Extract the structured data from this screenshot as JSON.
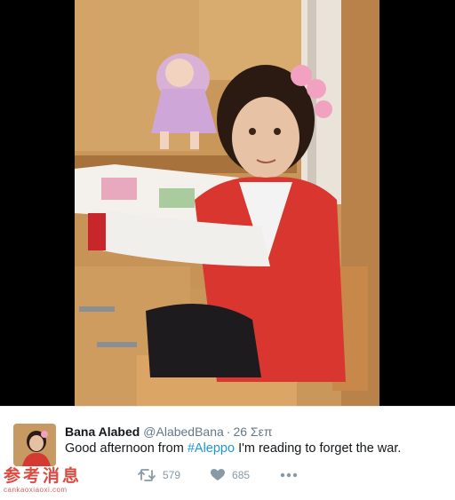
{
  "tweet": {
    "name": "Bana Alabed",
    "handle": "@AlabedBana",
    "separator": "·",
    "date": "26 Σεπ",
    "text_before": "Good afternoon from ",
    "hashtag": "#Aleppo",
    "text_after": " I'm reading to forget the war.",
    "retweets": "579",
    "likes": "685"
  },
  "watermark": {
    "chars": "参考消息",
    "url": "cankaoxiaoxi.com"
  },
  "colors": {
    "hashtag": "#1b95e0",
    "meta_text": "#657786",
    "action_icons": "#8899a6"
  },
  "icons": [
    "retweet-icon",
    "heart-icon",
    "more-icon"
  ]
}
